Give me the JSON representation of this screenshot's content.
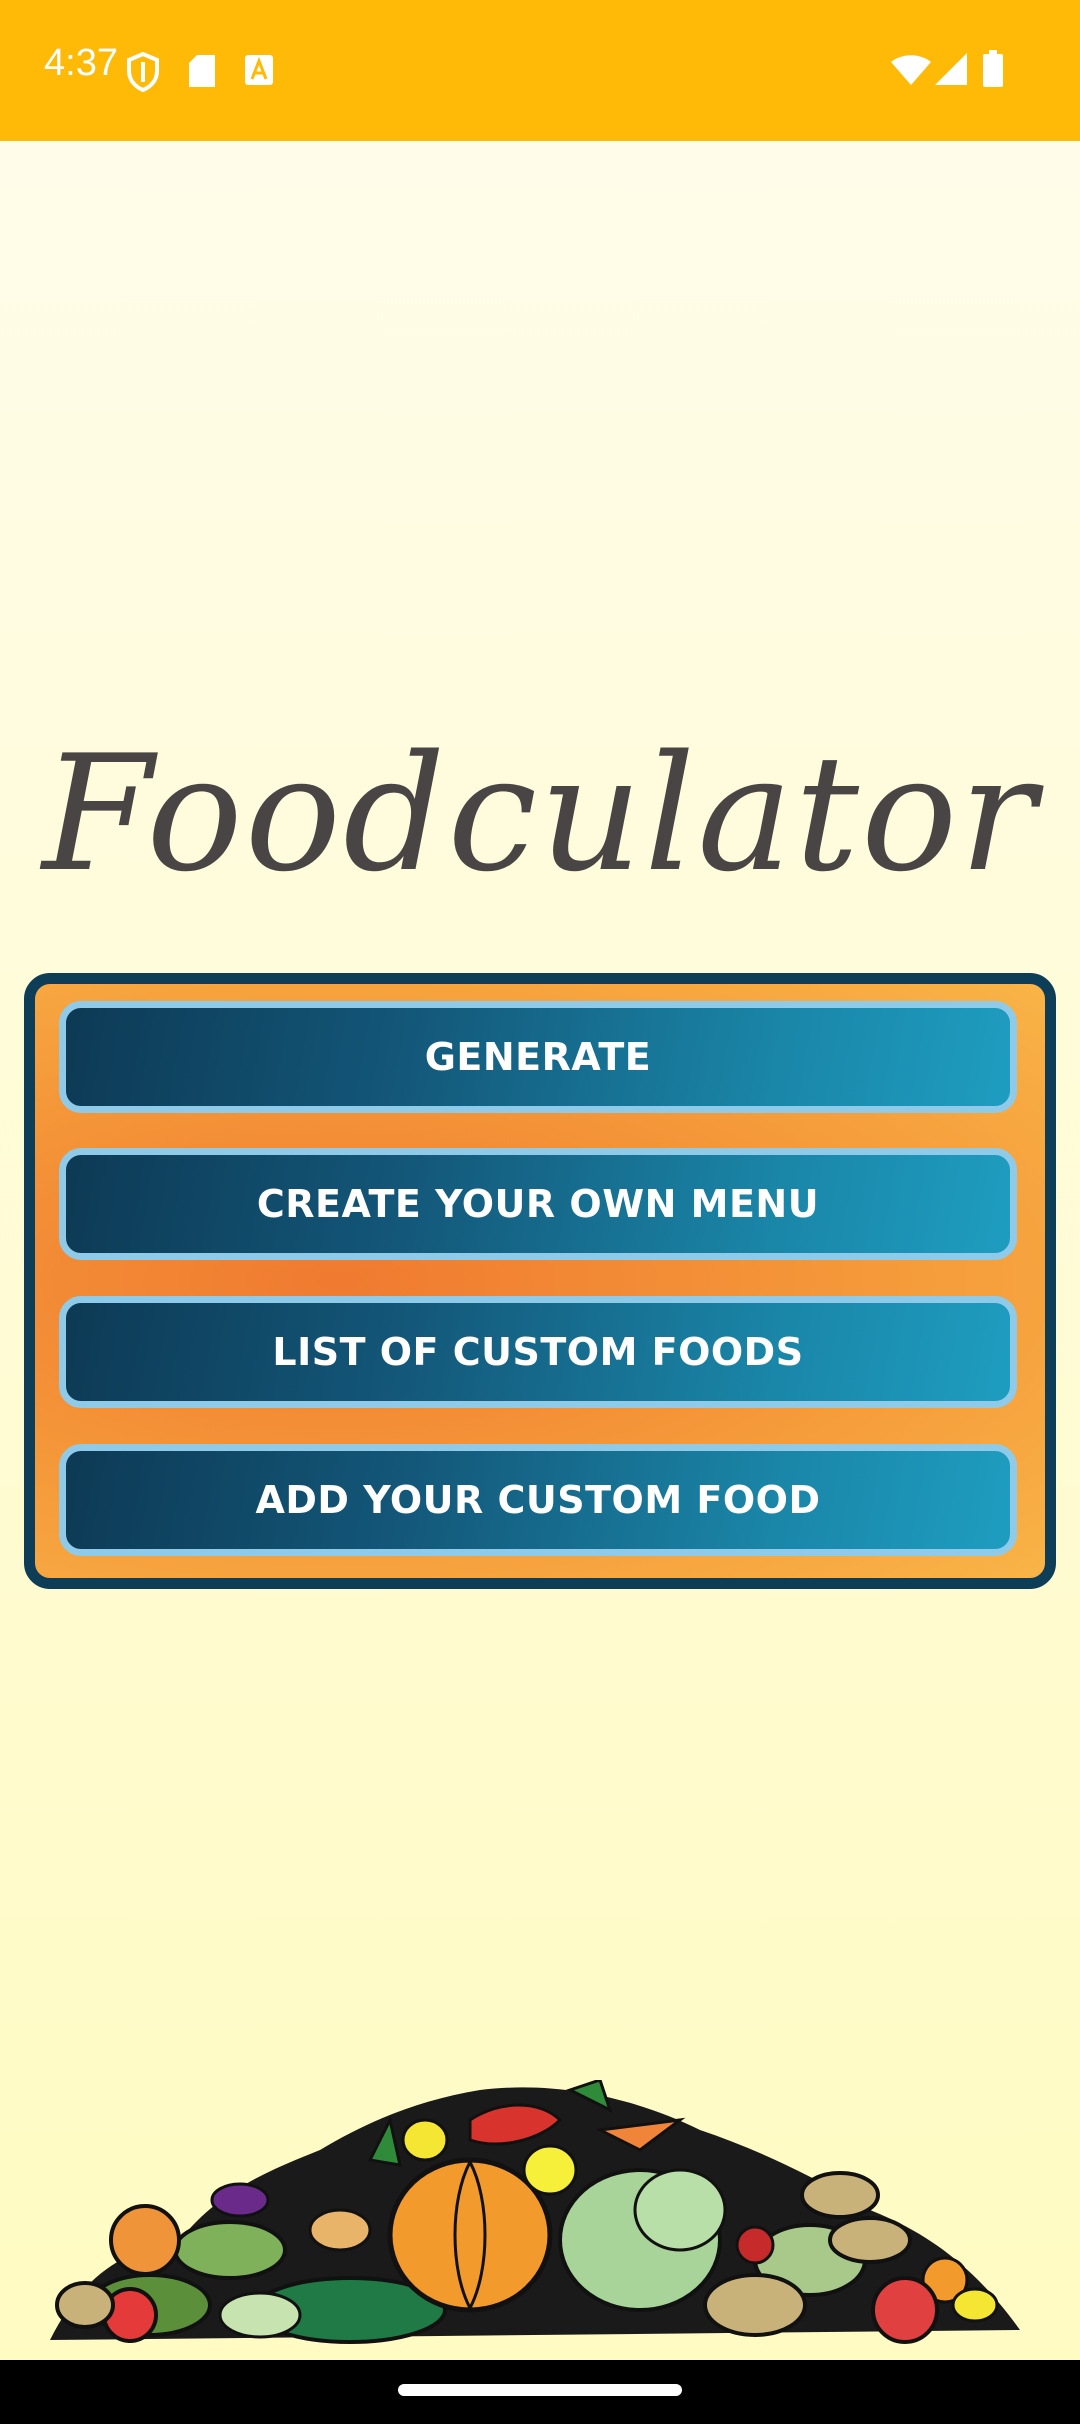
{
  "status_bar": {
    "time": "4:37",
    "left_icons": [
      "shield-icon",
      "sd-card-icon",
      "font-download-icon"
    ],
    "right_icons": [
      "wifi-icon",
      "cellular-signal-icon",
      "battery-icon"
    ]
  },
  "app": {
    "title": "Foodculator"
  },
  "menu": {
    "buttons": [
      {
        "label": "GENERATE"
      },
      {
        "label": "CREATE YOUR OWN MENU"
      },
      {
        "label": "LIST OF CUSTOM FOODS"
      },
      {
        "label": "ADD YOUR CUSTOM FOOD"
      }
    ]
  },
  "decoration": {
    "image": "vegetable-pile-illustration"
  },
  "colors": {
    "status_bar": "#ffb907",
    "panel_border": "#0e3d58",
    "button_border": "#8fcbe8",
    "title": "#4a4545"
  }
}
